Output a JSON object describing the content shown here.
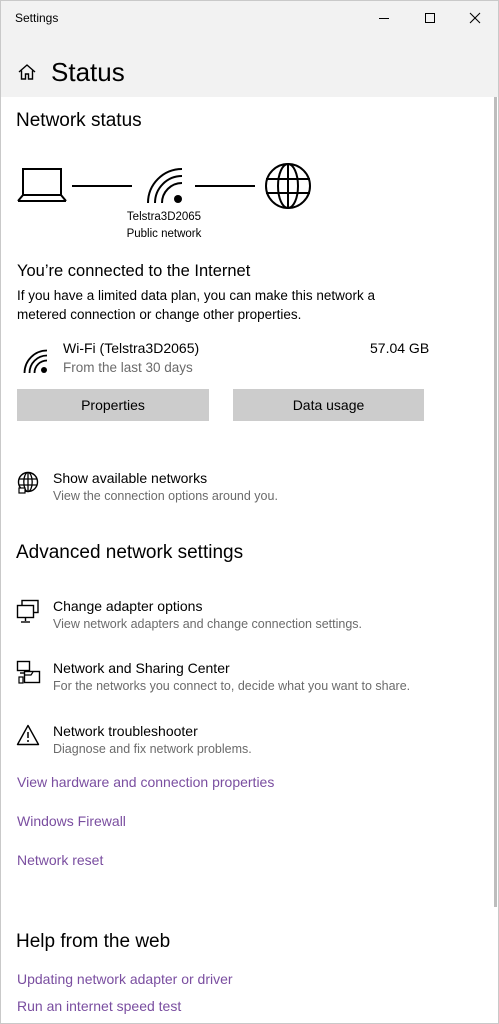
{
  "window": {
    "title": "Settings"
  },
  "header": {
    "title": "Status"
  },
  "network_status": {
    "heading": "Network status",
    "network_name": "Telstra3D2065",
    "network_type": "Public network"
  },
  "connection": {
    "heading": "You’re connected to the Internet",
    "description_line1": "If you have a limited data plan, you can make this network a",
    "description_line2": "metered connection or change other properties.",
    "adapter_name": "Wi-Fi (Telstra3D2065)",
    "adapter_sub": "From the last 30 days",
    "data_used": "57.04 GB",
    "properties_label": "Properties",
    "data_usage_label": "Data usage"
  },
  "available_networks": {
    "title": "Show available networks",
    "subtitle": "View the connection options around you."
  },
  "advanced": {
    "heading": "Advanced network settings",
    "items": [
      {
        "title": "Change adapter options",
        "subtitle": "View network adapters and change connection settings.",
        "icon": "adapter-icon"
      },
      {
        "title": "Network and Sharing Center",
        "subtitle": "For the networks you connect to, decide what you want to share.",
        "icon": "sharing-icon"
      },
      {
        "title": "Network troubleshooter",
        "subtitle": "Diagnose and fix network problems.",
        "icon": "warning-icon"
      }
    ],
    "links": [
      "View hardware and connection properties",
      "Windows Firewall",
      "Network reset"
    ]
  },
  "help": {
    "heading": "Help from the web",
    "links": [
      "Updating network adapter or driver",
      "Run an internet speed test"
    ]
  },
  "colors": {
    "link": "#7a4ea0",
    "header_bg": "#f2f2f2",
    "button_bg": "#cccccc",
    "secondary_text": "#6b6b6b"
  }
}
